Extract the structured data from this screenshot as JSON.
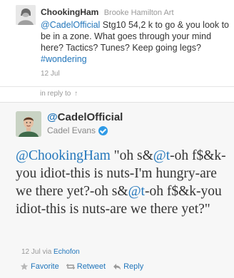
{
  "parent_tweet": {
    "username": "ChookingHam",
    "full_name": "Brooke Hamilton Art",
    "text_mention": "@CadelOfficial",
    "text_body": " Stg10 54,2 k to go & you look to be in a zone. What goes through your mind here? Tactics? Tunes? Keep going legs? ",
    "hashtag": "#wondering",
    "time": "12 Jul"
  },
  "reply_indicator": {
    "label": "in reply to",
    "arrow": "↑"
  },
  "main_tweet": {
    "at_sign": "@",
    "username": "CadelOfficial",
    "full_name": "Cadel Evans",
    "segments": [
      {
        "type": "mention",
        "text": "@ChookingHam"
      },
      {
        "type": "text",
        "text": " \"oh s&"
      },
      {
        "type": "mention",
        "text": "@t"
      },
      {
        "type": "text",
        "text": "-oh f$&k-you idiot-this is nuts-I'm hungry-are we there yet?-oh s&"
      },
      {
        "type": "mention",
        "text": "@t"
      },
      {
        "type": "text",
        "text": "-oh f$&k-you idiot-this is nuts-are we there yet?\""
      }
    ],
    "time": "12 Jul",
    "via_label": "via",
    "via_app": "Echofon"
  },
  "actions": {
    "favorite": "Favorite",
    "retweet": "Retweet",
    "reply": "Reply"
  },
  "colors": {
    "link": "#2276bb",
    "verified": "#2f9ae6",
    "muted": "#999999"
  }
}
